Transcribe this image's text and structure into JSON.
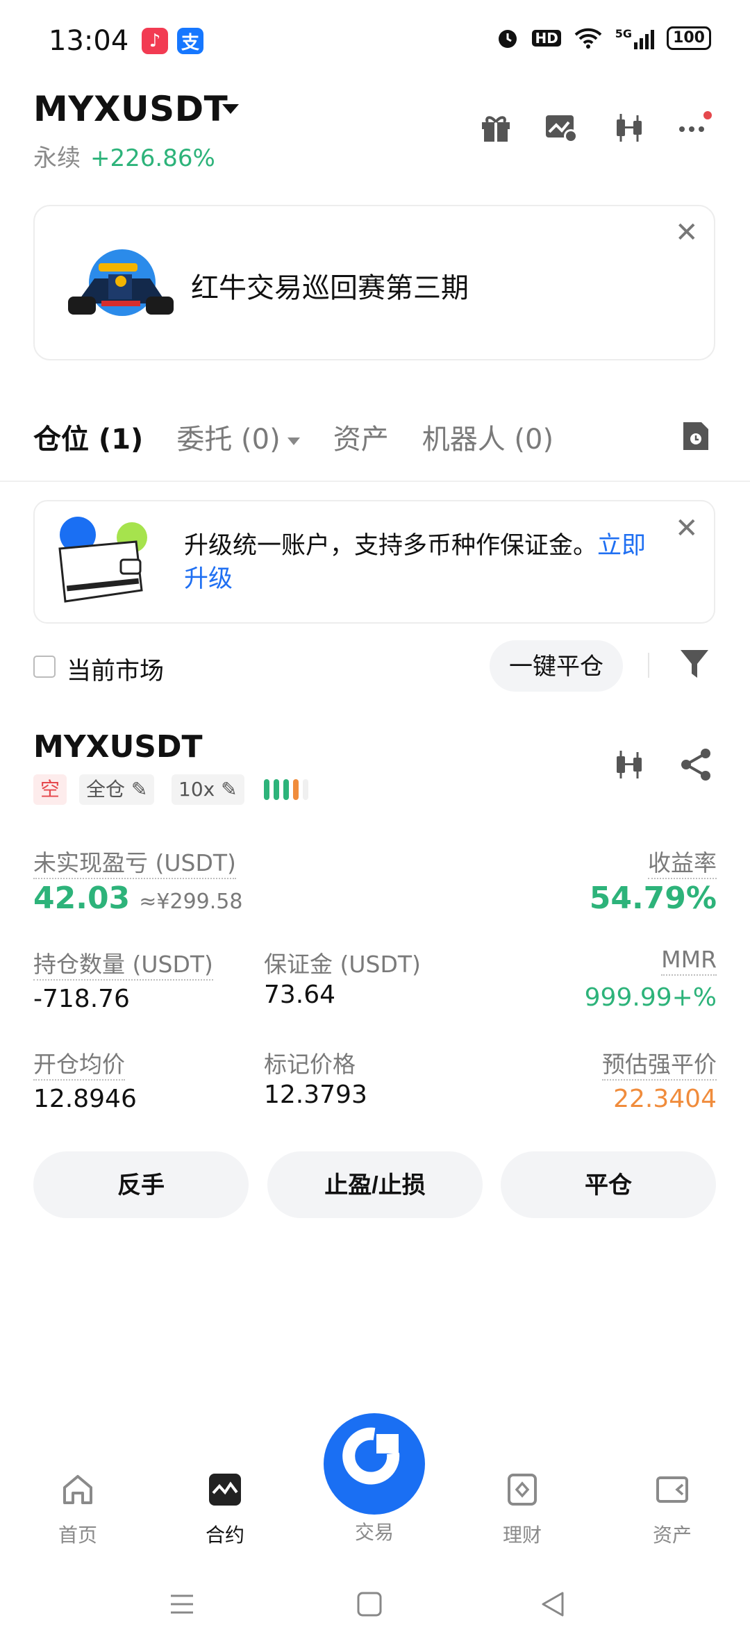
{
  "status_bar": {
    "time": "13:04",
    "battery": "100",
    "signal_label": "5G",
    "hd_label": "HD"
  },
  "header": {
    "pair": "MYXUSDT",
    "type": "永续",
    "change": "+226.86%"
  },
  "banner": {
    "title": "红牛交易巡回赛第三期"
  },
  "tabs": [
    {
      "label": "仓位 (1)"
    },
    {
      "label": "委托 (0)"
    },
    {
      "label": "资产"
    },
    {
      "label": "机器人 (0)"
    }
  ],
  "upgrade": {
    "text": "升级统一账户，支持多币种作保证金。",
    "link": "立即升级"
  },
  "filter": {
    "current_market": "当前市场",
    "close_all": "一键平仓"
  },
  "position": {
    "symbol": "MYXUSDT",
    "side": "空",
    "margin_mode": "全仓",
    "leverage": "10x",
    "unrealized_label": "未实现盈亏 (USDT)",
    "unrealized_value": "42.03",
    "unrealized_cny": "≈¥299.58",
    "roe_label": "收益率",
    "roe_value": "54.79%",
    "size_label": "持仓数量 (USDT)",
    "size_value": "-718.76",
    "margin_label": "保证金 (USDT)",
    "margin_value": "73.64",
    "mmr_label": "MMR",
    "mmr_value": "999.99+%",
    "entry_label": "开仓均价",
    "entry_value": "12.8946",
    "mark_label": "标记价格",
    "mark_value": "12.3793",
    "liq_label": "预估强平价",
    "liq_value": "22.3404"
  },
  "actions": {
    "reverse": "反手",
    "tpsl": "止盈/止损",
    "close": "平仓"
  },
  "bottom_nav": [
    {
      "label": "首页"
    },
    {
      "label": "合约"
    },
    {
      "label": "交易"
    },
    {
      "label": "理财"
    },
    {
      "label": "资产"
    }
  ],
  "colors": {
    "green": "#2db37a",
    "red": "#e5484d",
    "orange": "#f08c3c",
    "blue": "#1a6ff3",
    "link": "#1f6ff2"
  }
}
